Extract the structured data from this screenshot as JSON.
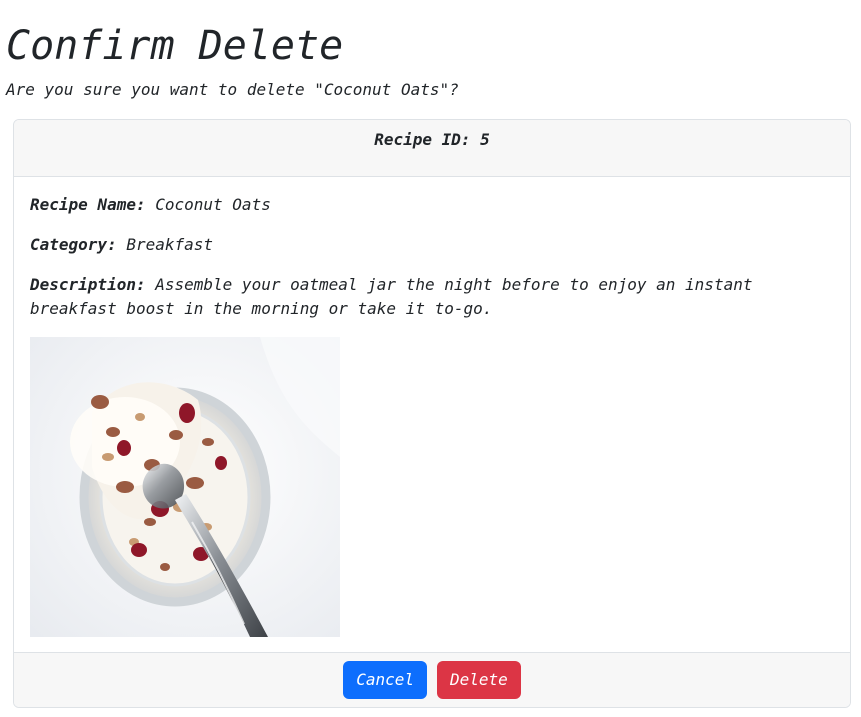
{
  "page": {
    "title": "Confirm Delete",
    "question": "Are you sure you want to delete \"Coconut Oats\"?"
  },
  "card": {
    "header": "Recipe ID: 5",
    "fields": {
      "name_label": "Recipe Name:",
      "name_value": "Coconut Oats",
      "category_label": "Category:",
      "category_value": "Breakfast",
      "description_label": "Description:",
      "description_value": "Assemble your oatmeal jar the night before to enjoy an instant breakfast boost in the morning or take it to-go."
    },
    "image": {
      "alt": "Coconut Oats",
      "icon": "recipe-photo"
    }
  },
  "actions": {
    "cancel_label": "Cancel",
    "delete_label": "Delete"
  },
  "colors": {
    "cancel": "#0d6efd",
    "delete": "#dc3545"
  }
}
